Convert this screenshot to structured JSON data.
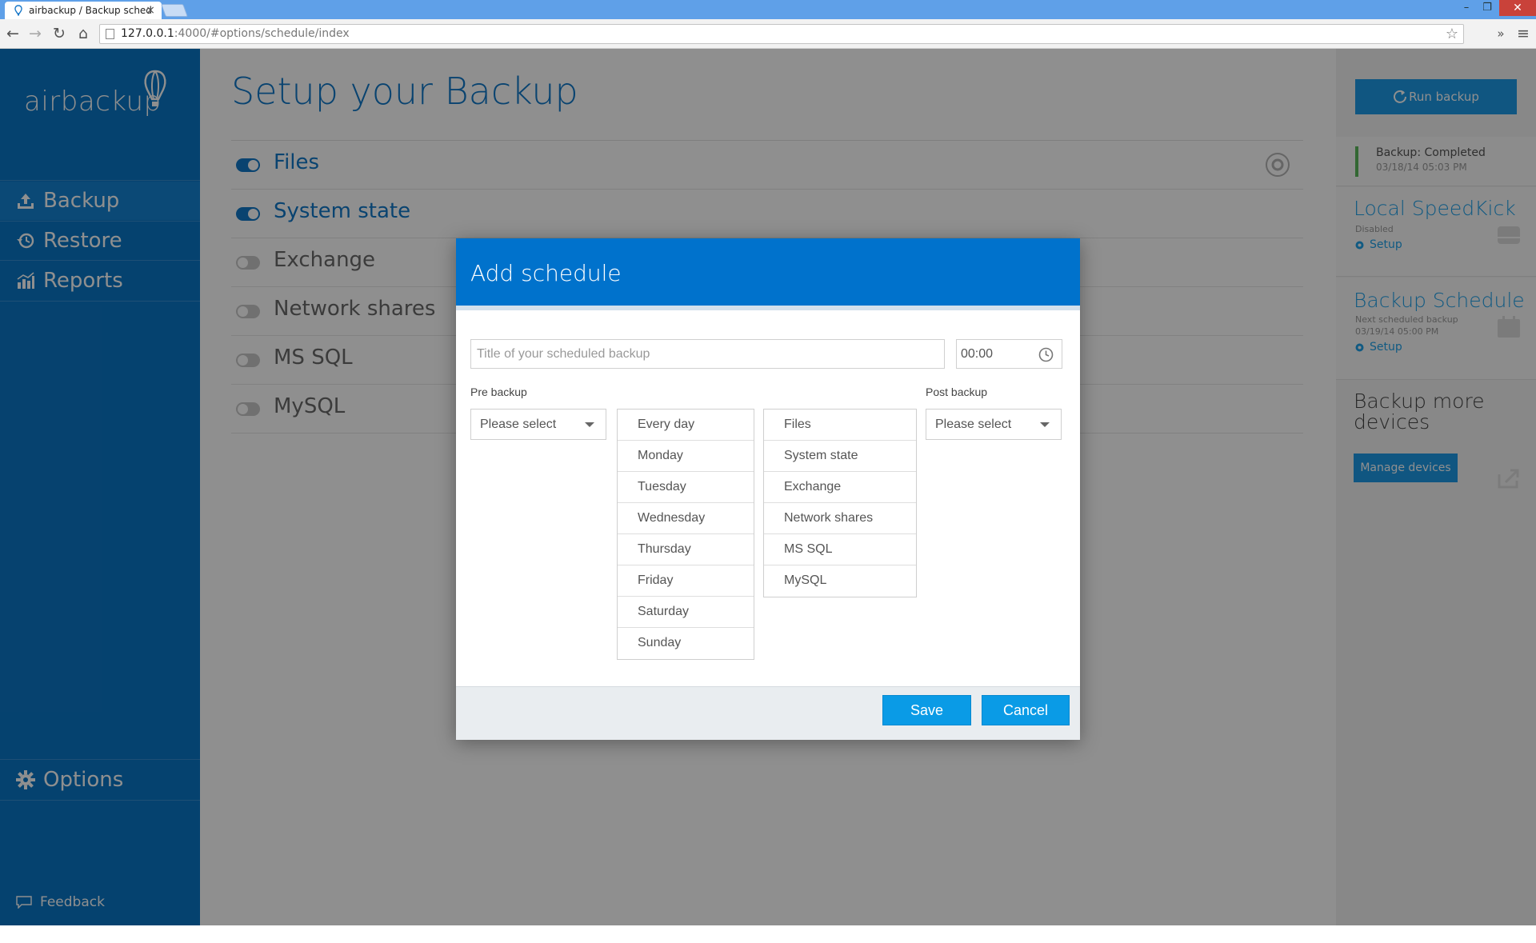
{
  "browser": {
    "tab_title": "airbackup / Backup sched",
    "tab_close": "×",
    "url_host": "127.0.0.1",
    "url_path": ":4000/#options/schedule/index",
    "window_buttons": {
      "minimize": "–",
      "restore": "❐",
      "close": "✕"
    },
    "nav": {
      "back": "←",
      "forward": "→",
      "reload": "↻",
      "home": "⌂",
      "extensions": "»",
      "menu": "≡",
      "star": "☆"
    }
  },
  "sidebar": {
    "logo": "airbackup",
    "items": [
      {
        "label": "Backup",
        "icon": "upload-icon",
        "active": true
      },
      {
        "label": "Restore",
        "icon": "history-icon",
        "active": false
      },
      {
        "label": "Reports",
        "icon": "bar-chart-icon",
        "active": false
      }
    ],
    "options_label": "Options",
    "feedback_label": "Feedback"
  },
  "main": {
    "title": "Setup your Backup",
    "features": [
      {
        "label": "Files",
        "enabled": true
      },
      {
        "label": "System state",
        "enabled": true
      },
      {
        "label": "Exchange",
        "enabled": false
      },
      {
        "label": "Network shares",
        "enabled": false
      },
      {
        "label": "MS SQL",
        "enabled": false
      },
      {
        "label": "MySQL",
        "enabled": false
      }
    ]
  },
  "right_panel": {
    "run_backup_label": "Run backup",
    "status": "Backup: Completed",
    "status_time": "03/18/14 05:03 PM",
    "speedkick": {
      "title": "Local SpeedKick",
      "state": "Disabled",
      "setup": "Setup"
    },
    "schedule": {
      "title": "Backup Schedule",
      "next_label": "Next scheduled backup",
      "next_time": "03/19/14 05:00 PM",
      "setup": "Setup"
    },
    "more_devices": {
      "title": "Backup more devices",
      "button": "Manage devices"
    }
  },
  "modal": {
    "title": "Add schedule",
    "title_placeholder": "Title of your scheduled backup",
    "time_value": "00:00",
    "pre_backup_label": "Pre backup",
    "post_backup_label": "Post backup",
    "pre_select": "Please select",
    "post_select": "Please select",
    "days": [
      "Every day",
      "Monday",
      "Tuesday",
      "Wednesday",
      "Thursday",
      "Friday",
      "Saturday",
      "Sunday"
    ],
    "types": [
      "Files",
      "System state",
      "Exchange",
      "Network shares",
      "MS SQL",
      "MySQL"
    ],
    "save_label": "Save",
    "cancel_label": "Cancel"
  },
  "colors": {
    "brand_blue": "#0072cc",
    "accent_blue": "#0a9be6",
    "sidebar_blue": "#0a76c6",
    "status_green": "#5cb85c"
  }
}
